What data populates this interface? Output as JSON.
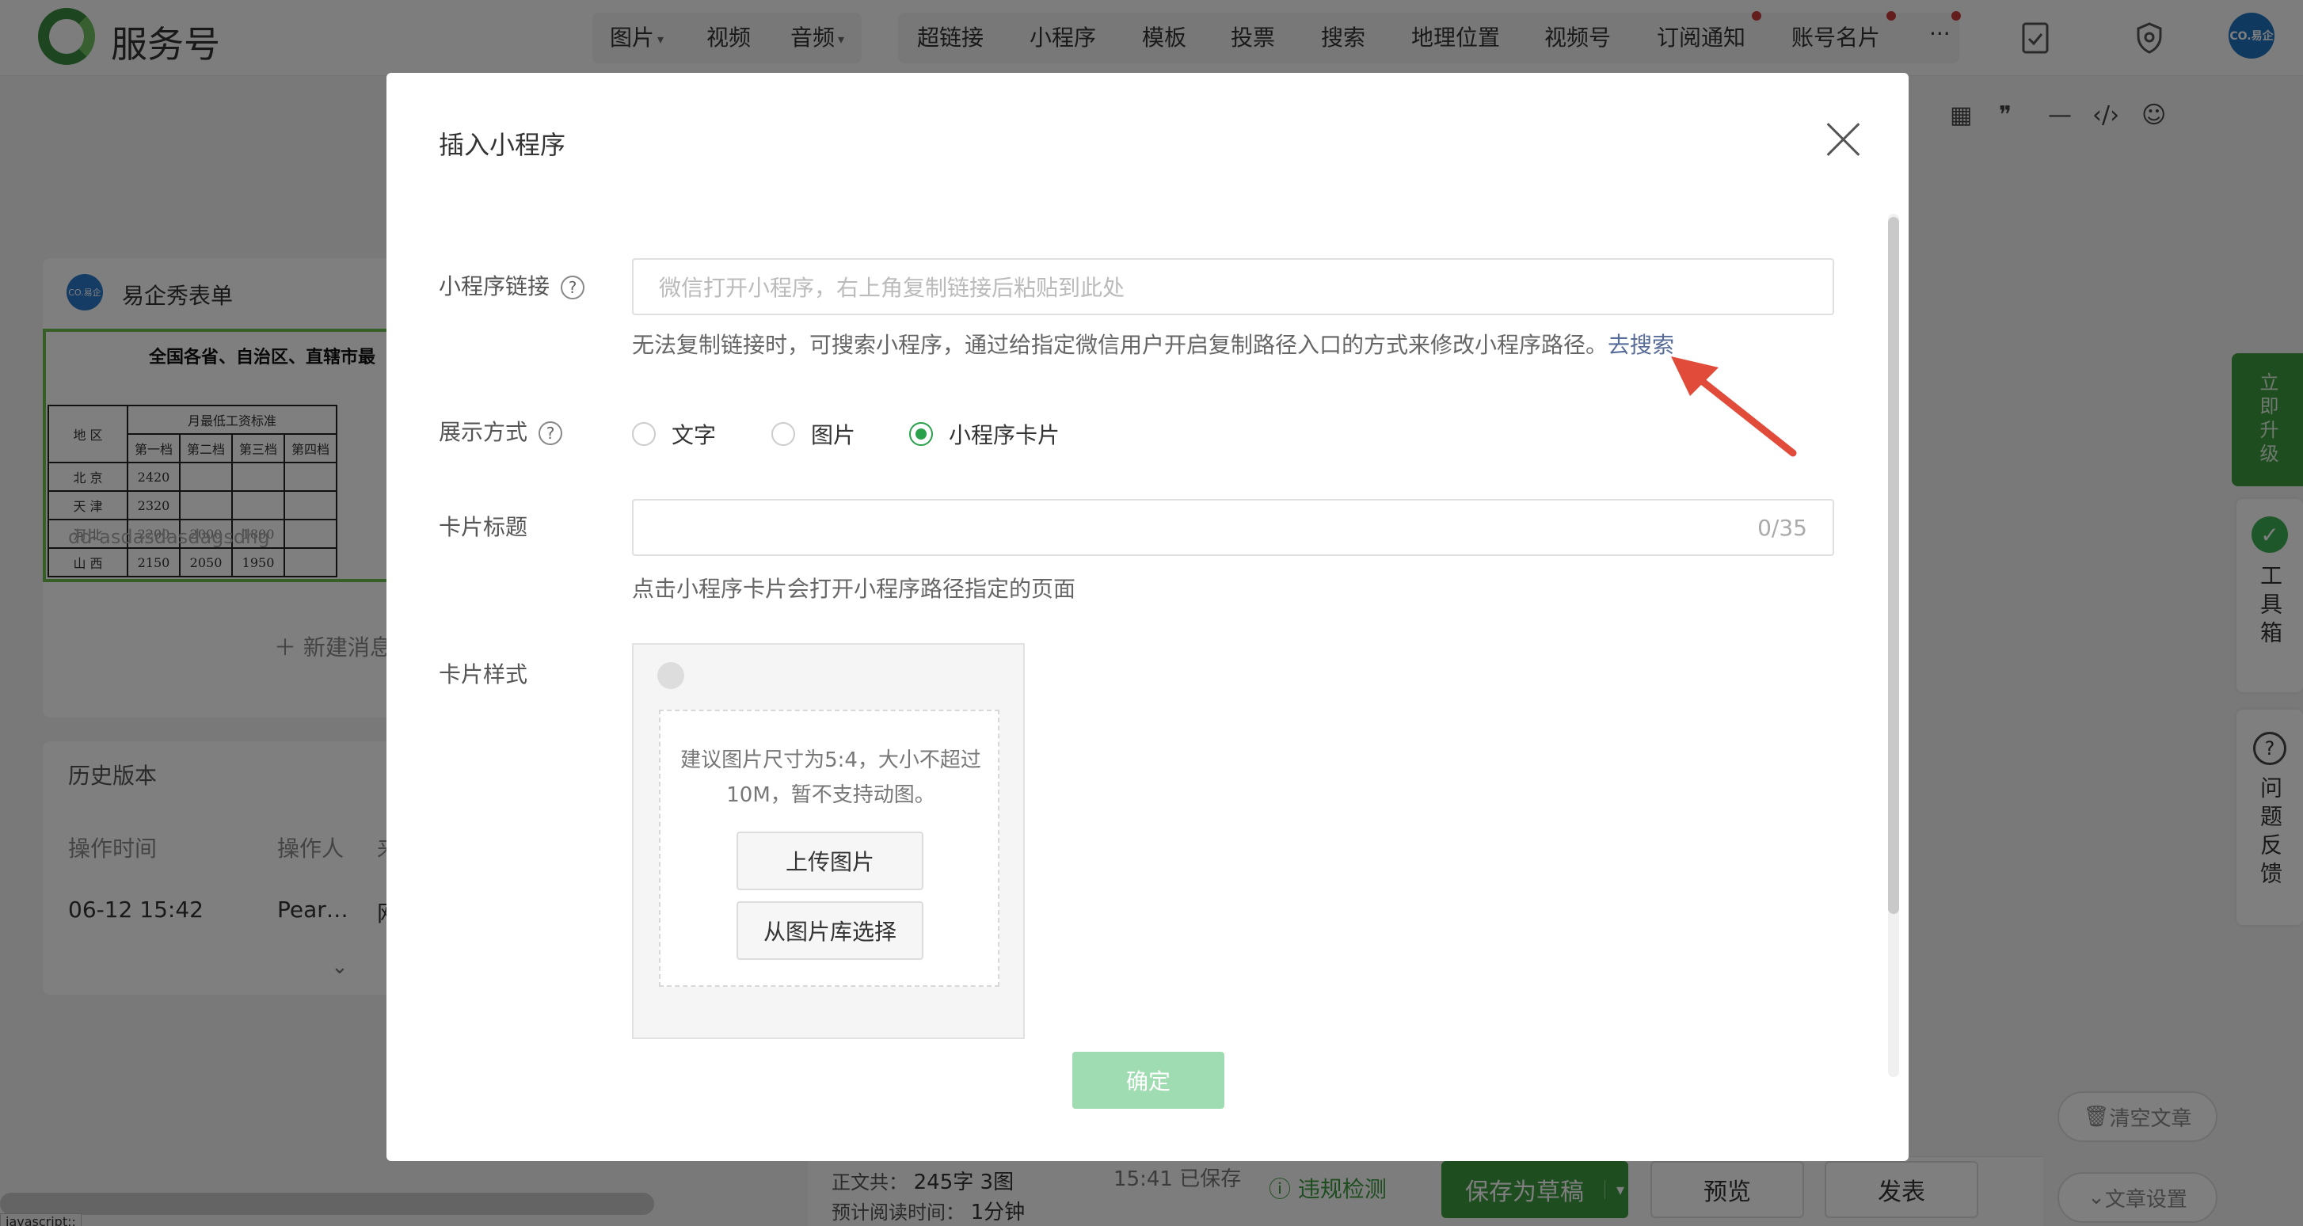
{
  "app": {
    "name": "服务号"
  },
  "toolbar": {
    "group1": [
      {
        "label": "图片",
        "caret": true
      },
      {
        "label": "视频",
        "caret": false
      },
      {
        "label": "音频",
        "caret": true
      }
    ],
    "group2": [
      {
        "label": "超链接"
      },
      {
        "label": "小程序"
      },
      {
        "label": "模板"
      },
      {
        "label": "投票"
      },
      {
        "label": "搜索"
      },
      {
        "label": "地理位置"
      },
      {
        "label": "视频号"
      },
      {
        "label": "订阅通知"
      },
      {
        "label": "账号名片"
      }
    ],
    "more": "···",
    "avatar_text": "CO.易企"
  },
  "editor_toolbar": {
    "icons": [
      "table-icon",
      "quote-icon",
      "divider-icon",
      "code-icon",
      "emoji-icon"
    ],
    "glyphs": [
      "▦",
      "❞",
      "—",
      "‹/›",
      "☺"
    ]
  },
  "left": {
    "account": "易企秀表单",
    "account_avatar": "CO.易企",
    "thumb_title": "全国各省、自治区、直辖市最",
    "thumb_table": {
      "header_region": "地 区",
      "header_group": "月最低工资标准",
      "tiers": [
        "第一档",
        "第二档",
        "第三档",
        "第四档"
      ],
      "rows": [
        [
          "北 京",
          "2420",
          "",
          "",
          ""
        ],
        [
          "天 津",
          "2320",
          "",
          "",
          ""
        ],
        [
          "河 北",
          "2200",
          "2000",
          "1800",
          ""
        ],
        [
          "山 西",
          "2150",
          "2050",
          "1950",
          ""
        ]
      ]
    },
    "watermark": "dd-asdasdasdagsdhg",
    "new_button": "新建消息",
    "history_title": "历史版本",
    "history_headers": [
      "操作时间",
      "操作人",
      "来"
    ],
    "history_rows": [
      {
        "time": "06-12 15:42",
        "user": "Pear…",
        "extra": "网"
      }
    ]
  },
  "right": {
    "upgrade": "立即升级",
    "toolbox": "工具箱",
    "feedback": "问题反馈",
    "clear": "清空文章",
    "settings": "文章设置"
  },
  "bottom": {
    "word_count_label": "正文共：",
    "word_count": "245字 3图",
    "saved": "15:41 已保存",
    "read_time_label": "预计阅读时间：",
    "read_time": "1分钟",
    "check": "违规检测",
    "save_draft": "保存为草稿",
    "preview": "预览",
    "publish": "发表"
  },
  "modal": {
    "title": "插入小程序",
    "link_label": "小程序链接",
    "link_placeholder": "微信打开小程序，右上角复制链接后粘贴到此处",
    "link_hint": "无法复制链接时，可搜索小程序，通过给指定微信用户开启复制路径入口的方式来修改小程序路径。",
    "link_hint_action": "去搜索",
    "display_label": "展示方式",
    "display_options": [
      "文字",
      "图片",
      "小程序卡片"
    ],
    "display_selected": "小程序卡片",
    "card_title_label": "卡片标题",
    "card_title_counter": "0/35",
    "card_title_hint": "点击小程序卡片会打开小程序路径指定的页面",
    "card_style_label": "卡片样式",
    "upload_hint": "建议图片尺寸为5:4，大小不超过10M，暂不支持动图。",
    "upload_button": "上传图片",
    "library_button": "从图片库选择",
    "confirm": "确定"
  },
  "status_text": "javascript:;",
  "colors": {
    "brand_green": "#3c9b3f",
    "link": "#586c99",
    "arrow": "#e04b3a",
    "confirm_disabled": "#9fdcb1"
  }
}
